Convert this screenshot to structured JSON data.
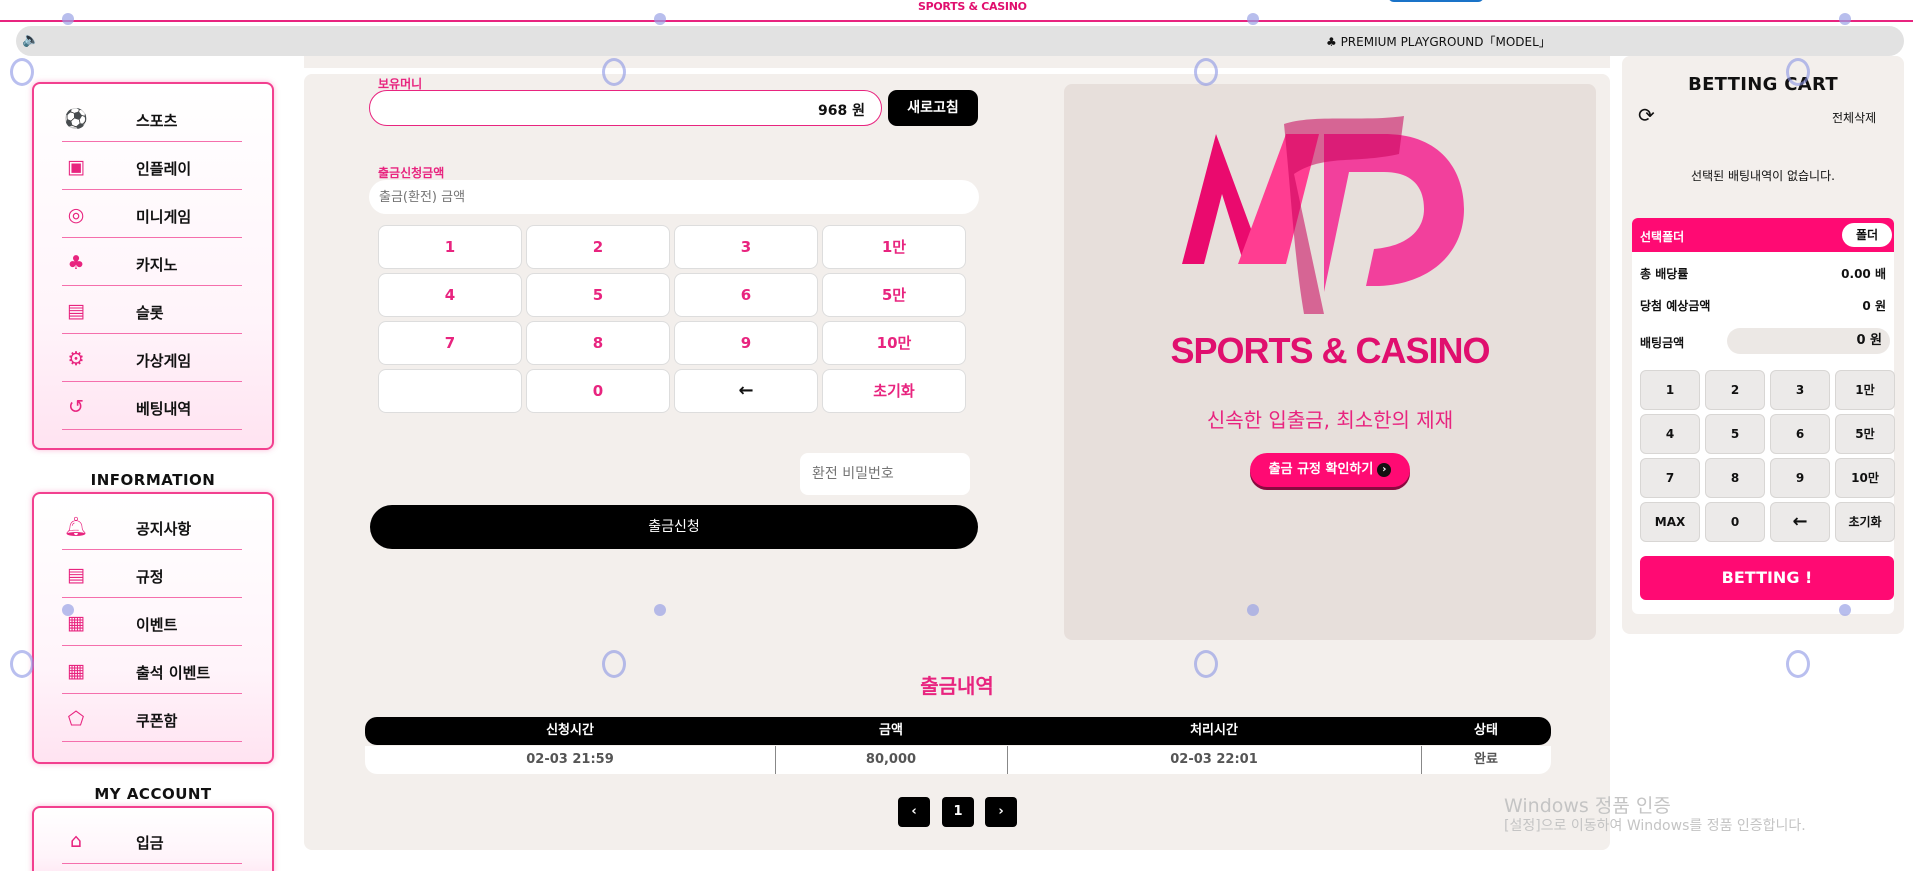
{
  "header": {
    "brand": "SPORTS & CASINO",
    "notice": "♣ PREMIUM PLAYGROUND「MODEL」"
  },
  "sidebar": {
    "games": [
      {
        "label": "스포츠",
        "icon": "soccer-icon"
      },
      {
        "label": "인플레이",
        "icon": "live-icon"
      },
      {
        "label": "미니게임",
        "icon": "minigame-icon"
      },
      {
        "label": "카지노",
        "icon": "casino-icon"
      },
      {
        "label": "슬롯",
        "icon": "slot-icon"
      },
      {
        "label": "가상게임",
        "icon": "virtual-icon"
      },
      {
        "label": "베팅내역",
        "icon": "history-icon"
      }
    ],
    "info_title": "INFORMATION",
    "info": [
      {
        "label": "공지사항",
        "icon": "bell-icon"
      },
      {
        "label": "규정",
        "icon": "document-icon"
      },
      {
        "label": "이벤트",
        "icon": "gift-icon"
      },
      {
        "label": "출석 이벤트",
        "icon": "gift-icon"
      },
      {
        "label": "쿠폰함",
        "icon": "coupon-icon"
      }
    ],
    "account_title": "MY ACCOUNT",
    "account": [
      {
        "label": "입금",
        "icon": "deposit-icon"
      }
    ]
  },
  "withdraw": {
    "holding_label": "보유머니",
    "holding_value": "968 원",
    "refresh_label": "새로고침",
    "amount_label": "출금신청금액",
    "amount_placeholder": "출금(환전) 금액",
    "keys": [
      "1",
      "2",
      "3",
      "1만",
      "4",
      "5",
      "6",
      "5만",
      "7",
      "8",
      "9",
      "10만",
      "",
      "0",
      "←",
      "초기화"
    ],
    "password_placeholder": "환전 비밀번호",
    "submit_label": "출금신청"
  },
  "banner": {
    "brand": "SPORTS & CASINO",
    "slogan": "신속한 입출금, 최소한의 제재",
    "rules_button": "출금 규정 확인하기"
  },
  "history": {
    "title": "출금내역",
    "columns": [
      "신청시간",
      "금액",
      "처리시간",
      "상태"
    ],
    "rows": [
      [
        "02-03 21:59",
        "80,000",
        "02-03 22:01",
        "완료"
      ]
    ],
    "pages": {
      "prev": "‹",
      "current": "1",
      "next": "›"
    }
  },
  "cart": {
    "title": "BETTING CART",
    "clear_label": "전체삭제",
    "empty_message": "선택된 배팅내역이 없습니다.",
    "folder_label": "선택폴더",
    "folder_button": "폴더",
    "total_odds_label": "총 배당률",
    "total_odds_value": "0.00 배",
    "expected_label": "당첨 예상금액",
    "expected_value": "0 원",
    "bet_label": "배팅금액",
    "bet_value": "0 원",
    "keys": [
      "1",
      "2",
      "3",
      "1만",
      "4",
      "5",
      "6",
      "5만",
      "7",
      "8",
      "9",
      "10만",
      "MAX",
      "0",
      "←",
      "초기화"
    ],
    "bet_button": "BETTING !"
  },
  "watermark": {
    "line1": "Windows 정품 인증",
    "line2": "[설정]으로 이동하여 Windows를 정품 인증합니다."
  },
  "colors": {
    "accent": "#ff0a73",
    "accent_text": "#e8247f",
    "panel_bg": "#f3efec"
  }
}
